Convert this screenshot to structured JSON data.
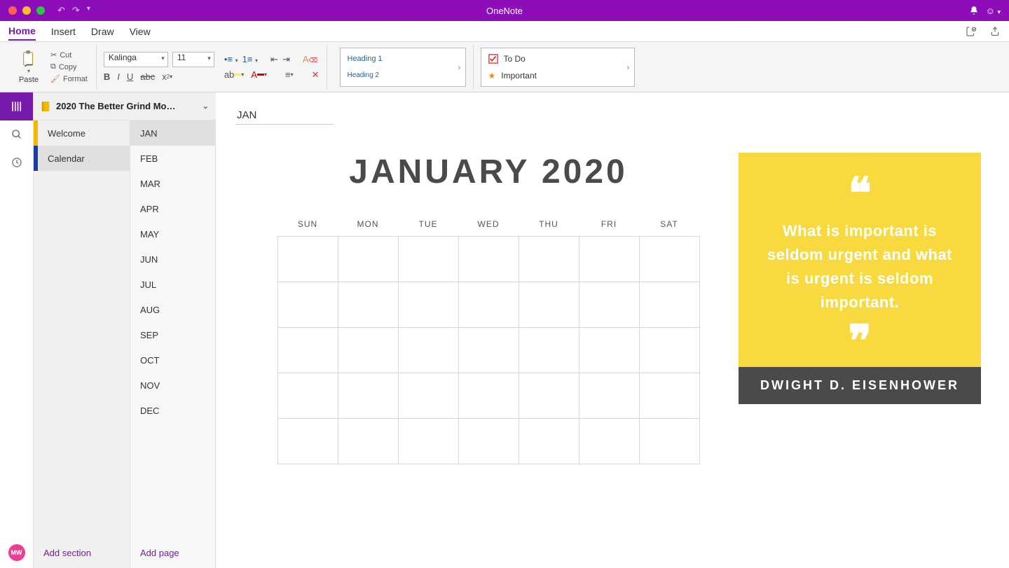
{
  "app": {
    "title": "OneNote"
  },
  "titlebar": {
    "undo": "undo-icon",
    "redo": "redo-icon"
  },
  "menubar": {
    "tabs": [
      "Home",
      "Insert",
      "Draw",
      "View"
    ],
    "active": 0
  },
  "ribbon": {
    "paste": "Paste",
    "cut": "Cut",
    "copy": "Copy",
    "format": "Format",
    "font_name": "Kalinga",
    "font_size": "11",
    "styles": [
      "Heading 1",
      "Heading 2"
    ],
    "tags": [
      {
        "icon": "checkbox",
        "label": "To Do"
      },
      {
        "icon": "star",
        "label": "Important"
      }
    ]
  },
  "sidebar": {
    "notebook_name": "2020 The Better Grind Mo…",
    "avatar_initials": "MW",
    "sections": [
      {
        "name": "Welcome",
        "color": "yellow",
        "active": false
      },
      {
        "name": "Calendar",
        "color": "blue",
        "active": true
      }
    ],
    "pages": [
      "JAN",
      "FEB",
      "MAR",
      "APR",
      "MAY",
      "JUN",
      "JUL",
      "AUG",
      "SEP",
      "OCT",
      "NOV",
      "DEC"
    ],
    "active_page": 0,
    "add_section": "Add section",
    "add_page": "Add page"
  },
  "page": {
    "title": "JAN",
    "calendar_title": "JANUARY 2020",
    "days": [
      "SUN",
      "MON",
      "TUE",
      "WED",
      "THU",
      "FRI",
      "SAT"
    ],
    "quote_text": "What is important is seldom urgent and what is urgent is seldom important.",
    "quote_author": "DWIGHT D. EISENHOWER"
  }
}
